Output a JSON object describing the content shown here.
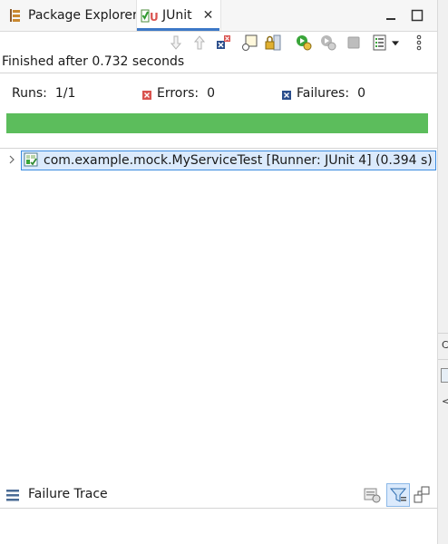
{
  "tabs": [
    {
      "label": "Package Explorer",
      "icon": "package-explorer-icon"
    },
    {
      "label": "JUnit",
      "icon": "junit-icon",
      "close": "✕"
    }
  ],
  "status": {
    "text": "Finished after 0.732 seconds"
  },
  "counters": {
    "runs_label": "Runs:",
    "runs_value": "1/1",
    "errors_label": "Errors:",
    "errors_value": "0",
    "failures_label": "Failures:",
    "failures_value": "0"
  },
  "progress": {
    "fraction": 1.0,
    "color": "#5cbd5c"
  },
  "tree": {
    "items": [
      {
        "label": "com.example.mock.MyServiceTest [Runner: JUnit 4] (0.394 s)",
        "expanded": false
      }
    ]
  },
  "failure_trace": {
    "title": "Failure Trace"
  },
  "colors": {
    "accent": "#3c78c7",
    "error": "#d9534f",
    "failure": "#2b4e8c",
    "success": "#5cbd5c"
  },
  "edge": {
    "glyph_1": "C",
    "glyph_2": "<"
  }
}
